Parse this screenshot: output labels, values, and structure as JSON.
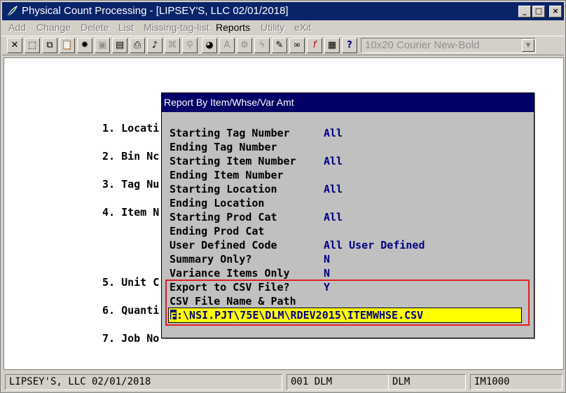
{
  "window": {
    "title": "Physical Count Processing - [LIPSEY'S, LLC 02/01/2018]",
    "app_icon": "feather-app-icon",
    "controls": {
      "minimize": "_",
      "maximize": "□",
      "close": "×"
    }
  },
  "menu": {
    "items": [
      {
        "label": "Add",
        "enabled": false
      },
      {
        "label": "Change",
        "enabled": false
      },
      {
        "label": "Delete",
        "enabled": false
      },
      {
        "label": "List",
        "enabled": false
      },
      {
        "label": "Missing-tag-list",
        "enabled": false
      },
      {
        "label": "Reports",
        "enabled": true
      },
      {
        "label": "Utility",
        "enabled": false
      },
      {
        "label": "eXit",
        "enabled": false
      }
    ]
  },
  "toolbar": {
    "buttons": [
      {
        "icon": "close-x-icon",
        "glyph": "✕"
      },
      {
        "icon": "select-rect-icon",
        "glyph": "⬚"
      },
      {
        "icon": "copy-icon",
        "glyph": "⧉"
      },
      {
        "icon": "paste-icon",
        "glyph": "📋"
      },
      {
        "icon": "settings-gear-icon",
        "glyph": "✹"
      },
      {
        "icon": "properties-icon",
        "glyph": "▣"
      },
      {
        "icon": "document-icon",
        "glyph": "▤"
      },
      {
        "icon": "print-icon",
        "glyph": "⎙"
      },
      {
        "icon": "bell-icon",
        "glyph": "♪"
      },
      {
        "icon": "binoculars-icon",
        "glyph": "⌘"
      },
      {
        "icon": "magnifier-icon",
        "glyph": "⚲"
      },
      {
        "icon": "globe-icon",
        "glyph": "◕"
      },
      {
        "icon": "font-a-icon",
        "glyph": "A"
      },
      {
        "icon": "stamp-icon",
        "glyph": "⚙"
      },
      {
        "icon": "lightning-icon",
        "glyph": "ϟ"
      },
      {
        "icon": "edit-page-icon",
        "glyph": "✎"
      },
      {
        "icon": "link-icon",
        "glyph": "∞"
      },
      {
        "icon": "function-icon",
        "glyph": "f"
      },
      {
        "icon": "calculator-icon",
        "glyph": "▦"
      },
      {
        "icon": "help-pointer-icon",
        "glyph": "?"
      }
    ],
    "font_selector": {
      "value": "10x20 Courier New-Bold"
    }
  },
  "main_menu": {
    "items": [
      {
        "label": "1. Locati"
      },
      {
        "label": "2. Bin Nc"
      },
      {
        "label": "3. Tag Nu"
      },
      {
        "label": "4. Item N"
      },
      {
        "label": "5. Unit C"
      },
      {
        "label": "6. Quanti"
      },
      {
        "label": "7. Job No"
      }
    ]
  },
  "dialog": {
    "title": "Report By Item/Whse/Var Amt",
    "fields": [
      {
        "label": "Starting Tag Number",
        "value": "All"
      },
      {
        "label": "Ending Tag Number",
        "value": ""
      },
      {
        "label": "Starting Item Number",
        "value": "All"
      },
      {
        "label": "Ending Item Number",
        "value": ""
      },
      {
        "label": "Starting Location",
        "value": "All"
      },
      {
        "label": "Ending Location",
        "value": ""
      },
      {
        "label": "Starting Prod Cat",
        "value": "All"
      },
      {
        "label": "Ending Prod Cat",
        "value": ""
      },
      {
        "label": "User Defined Code",
        "value": "All User Defined"
      },
      {
        "label": "Summary Only?",
        "value": "N"
      },
      {
        "label": "Variance Items Only",
        "value": "N"
      }
    ],
    "export_csv": {
      "label": "Export to CSV File?",
      "value": "Y"
    },
    "csv_path": {
      "label": "CSV File Name & Path",
      "value": ":\\NSI.PJT\\75E\\DLM\\RDEV2015\\ITEMWHSE.CSV",
      "cursor_char": "F"
    }
  },
  "status": {
    "company": "LIPSEY'S, LLC 02/01/2018",
    "user": "001 DLM",
    "user_short": "DLM",
    "module": "IM1000"
  },
  "colors": {
    "title_bar": "#0a246a",
    "dialog_title": "#000066",
    "field_value": "#000080",
    "highlight_box": "#e02020",
    "input_bg": "#ffff00"
  }
}
